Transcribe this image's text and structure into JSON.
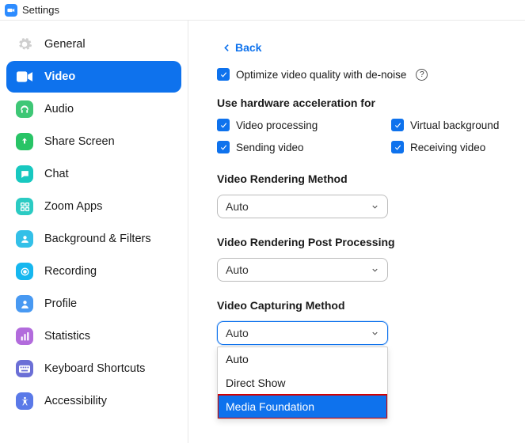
{
  "window": {
    "title": "Settings"
  },
  "sidebar": {
    "items": [
      {
        "label": "General"
      },
      {
        "label": "Video"
      },
      {
        "label": "Audio"
      },
      {
        "label": "Share Screen"
      },
      {
        "label": "Chat"
      },
      {
        "label": "Zoom Apps"
      },
      {
        "label": "Background & Filters"
      },
      {
        "label": "Recording"
      },
      {
        "label": "Profile"
      },
      {
        "label": "Statistics"
      },
      {
        "label": "Keyboard Shortcuts"
      },
      {
        "label": "Accessibility"
      }
    ]
  },
  "main": {
    "back_label": "Back",
    "optimize_label": "Optimize video quality with de-noise",
    "hw_section_label": "Use hardware acceleration for",
    "hw": {
      "video_processing": "Video processing",
      "virtual_background": "Virtual background",
      "sending_video": "Sending video",
      "receiving_video": "Receiving video"
    },
    "render_method_label": "Video Rendering Method",
    "render_method_value": "Auto",
    "post_processing_label": "Video Rendering Post Processing",
    "post_processing_value": "Auto",
    "capturing_label": "Video Capturing Method",
    "capturing_value": "Auto",
    "capturing_options": {
      "o0": "Auto",
      "o1": "Direct Show",
      "o2": "Media Foundation"
    }
  }
}
